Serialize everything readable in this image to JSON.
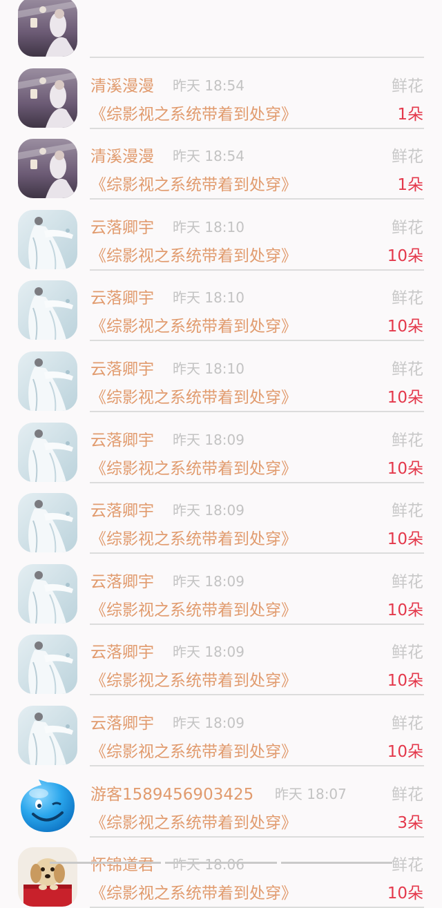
{
  "colors": {
    "name": "#e19b6e",
    "book_title": "#e19b6e",
    "time": "#c3c3c3",
    "gift_type": "#c8c8c8",
    "count": "#e4384b",
    "background": "#fbf9fa"
  },
  "records": [
    {
      "user": "",
      "time": "",
      "gift": "",
      "book": "",
      "count": "",
      "avatar": "lantern-girl"
    },
    {
      "user": "清溪漫漫",
      "time": "昨天 18:54",
      "gift": "鲜花",
      "book": "《综影视之系统带着到处穿》",
      "count": "1朵",
      "avatar": "lantern-girl"
    },
    {
      "user": "清溪漫漫",
      "time": "昨天 18:54",
      "gift": "鲜花",
      "book": "《综影视之系统带着到处穿》",
      "count": "1朵",
      "avatar": "lantern-girl"
    },
    {
      "user": "云落卿宇",
      "time": "昨天 18:10",
      "gift": "鲜花",
      "book": "《综影视之系统带着到处穿》",
      "count": "10朵",
      "avatar": "white-robe"
    },
    {
      "user": "云落卿宇",
      "time": "昨天 18:10",
      "gift": "鲜花",
      "book": "《综影视之系统带着到处穿》",
      "count": "10朵",
      "avatar": "white-robe"
    },
    {
      "user": "云落卿宇",
      "time": "昨天 18:10",
      "gift": "鲜花",
      "book": "《综影视之系统带着到处穿》",
      "count": "10朵",
      "avatar": "white-robe"
    },
    {
      "user": "云落卿宇",
      "time": "昨天 18:09",
      "gift": "鲜花",
      "book": "《综影视之系统带着到处穿》",
      "count": "10朵",
      "avatar": "white-robe"
    },
    {
      "user": "云落卿宇",
      "time": "昨天 18:09",
      "gift": "鲜花",
      "book": "《综影视之系统带着到处穿》",
      "count": "10朵",
      "avatar": "white-robe"
    },
    {
      "user": "云落卿宇",
      "time": "昨天 18:09",
      "gift": "鲜花",
      "book": "《综影视之系统带着到处穿》",
      "count": "10朵",
      "avatar": "white-robe"
    },
    {
      "user": "云落卿宇",
      "time": "昨天 18:09",
      "gift": "鲜花",
      "book": "《综影视之系统带着到处穿》",
      "count": "10朵",
      "avatar": "white-robe"
    },
    {
      "user": "云落卿宇",
      "time": "昨天 18:09",
      "gift": "鲜花",
      "book": "《综影视之系统带着到处穿》",
      "count": "10朵",
      "avatar": "white-robe"
    },
    {
      "user": "游客1589456903425",
      "time": "昨天 18:07",
      "gift": "鲜花",
      "book": "《综影视之系统带着到处穿》",
      "count": "3朵",
      "avatar": "blue-smiley"
    },
    {
      "user": "怀锦道君",
      "time": "昨天 18:06",
      "gift": "鲜花",
      "book": "《综影视之系统带着到处穿》",
      "count": "10朵",
      "avatar": "puppy"
    }
  ]
}
